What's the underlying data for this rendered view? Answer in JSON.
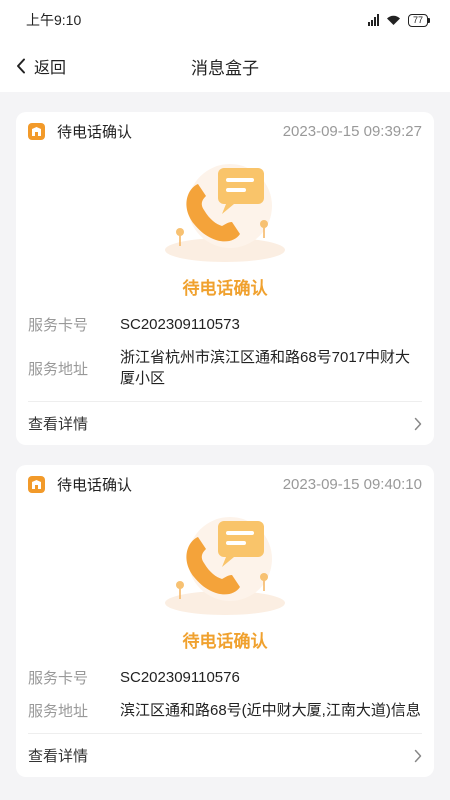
{
  "status_bar": {
    "time": "上午9:10",
    "battery": "77"
  },
  "nav": {
    "back_label": "返回",
    "title": "消息盒子"
  },
  "cards": [
    {
      "type_label": "待电话确认",
      "time": "2023-09-15 09:39:27",
      "status": "待电话确认",
      "fields": [
        {
          "label": "服务卡号",
          "value": "SC202309110573"
        },
        {
          "label": "服务地址",
          "value": "浙江省杭州市滨江区通和路68号7017中财大厦小区"
        }
      ],
      "detail_label": "查看详情"
    },
    {
      "type_label": "待电话确认",
      "time": "2023-09-15 09:40:10",
      "status": "待电话确认",
      "fields": [
        {
          "label": "服务卡号",
          "value": "SC202309110576"
        },
        {
          "label": "服务地址",
          "value": "滨江区通和路68号(近中财大厦,江南大道)信息"
        }
      ],
      "detail_label": "查看详情"
    }
  ],
  "colors": {
    "accent": "#f0a12e",
    "icon_bg": "#f29a2a"
  }
}
